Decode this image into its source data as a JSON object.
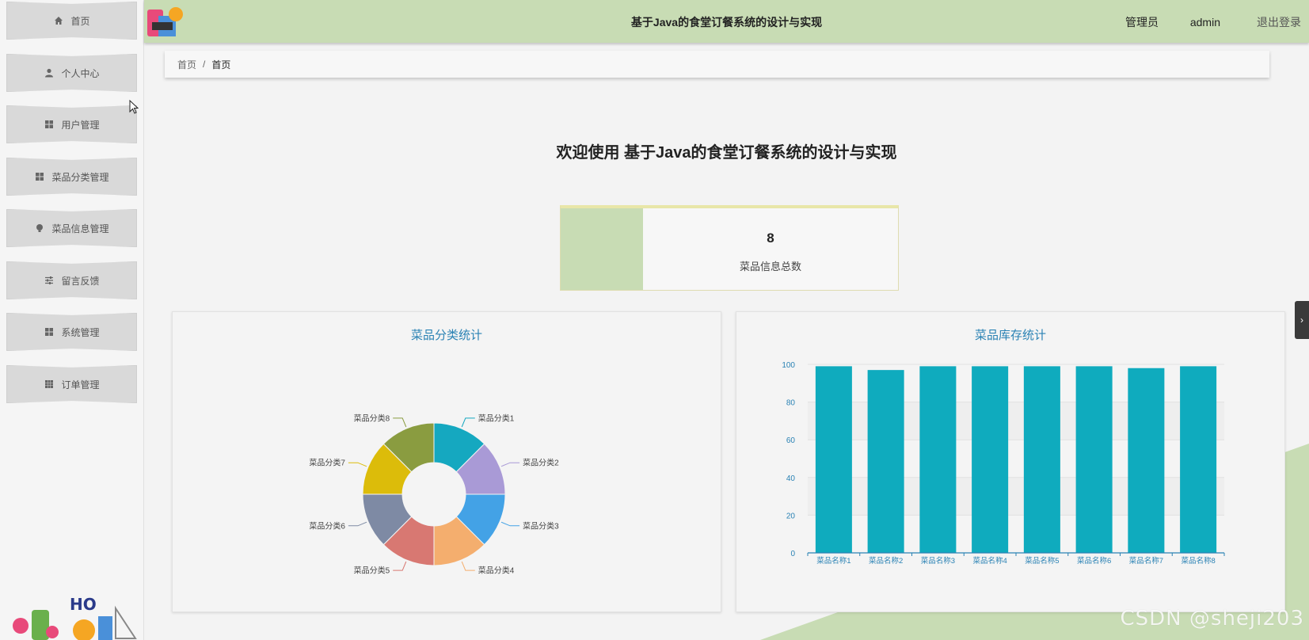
{
  "header": {
    "title": "基于Java的食堂订餐系统的设计与实现",
    "user_role": "管理员",
    "username": "admin",
    "logout_label": "退出登录"
  },
  "sidebar": {
    "items": [
      {
        "label": "首页",
        "icon": "home-icon"
      },
      {
        "label": "个人中心",
        "icon": "user-icon"
      },
      {
        "label": "用户管理",
        "icon": "grid-icon"
      },
      {
        "label": "菜品分类管理",
        "icon": "grid-icon"
      },
      {
        "label": "菜品信息管理",
        "icon": "bulb-icon"
      },
      {
        "label": "留言反馈",
        "icon": "sliders-icon"
      },
      {
        "label": "系统管理",
        "icon": "grid-icon"
      },
      {
        "label": "订单管理",
        "icon": "table-icon"
      }
    ]
  },
  "breadcrumb": {
    "root": "首页",
    "separator": "/",
    "current": "首页"
  },
  "welcome": "欢迎使用 基于Java的食堂订餐系统的设计与实现",
  "stat": {
    "value": "8",
    "label": "菜品信息总数"
  },
  "watermark": "CSDN @sheji203",
  "colors": {
    "accent_green": "#c8dcb4",
    "chart_title": "#2a82b4",
    "bar": "#0fabbe"
  },
  "chart_data": [
    {
      "type": "pie",
      "variant": "donut",
      "title": "菜品分类统计",
      "categories": [
        "菜品分类1",
        "菜品分类2",
        "菜品分类3",
        "菜品分类4",
        "菜品分类5",
        "菜品分类6",
        "菜品分类7",
        "菜品分类8"
      ],
      "values": [
        1,
        1,
        1,
        1,
        1,
        1,
        1,
        1
      ],
      "colors": [
        "#15a8c0",
        "#a99ad6",
        "#43a2e6",
        "#f4ae6e",
        "#d87872",
        "#7e8aa4",
        "#dcbc0a",
        "#8a9c40"
      ]
    },
    {
      "type": "bar",
      "title": "菜品库存统计",
      "categories": [
        "菜品名称1",
        "菜品名称2",
        "菜品名称3",
        "菜品名称4",
        "菜品名称5",
        "菜品名称6",
        "菜品名称7",
        "菜品名称8"
      ],
      "values": [
        99,
        97,
        99,
        99,
        99,
        99,
        98,
        99
      ],
      "ylim": [
        0,
        100
      ],
      "yticks": [
        0,
        20,
        40,
        60,
        80,
        100
      ],
      "grid": true
    }
  ]
}
